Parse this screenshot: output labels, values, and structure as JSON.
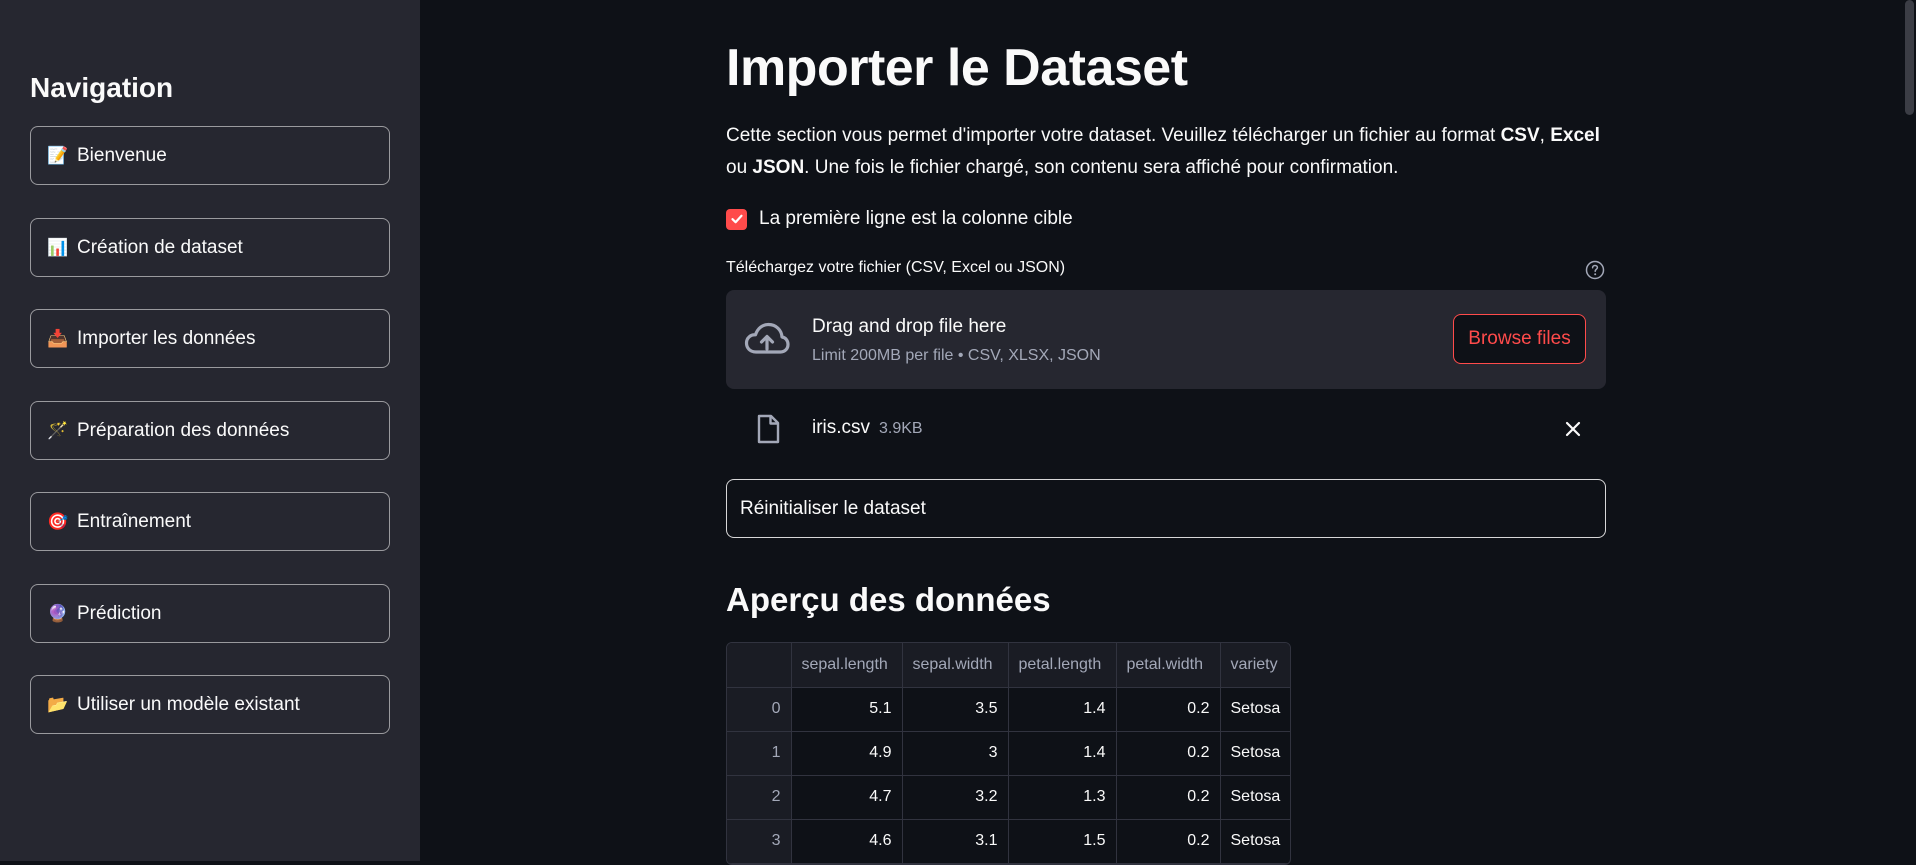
{
  "sidebar": {
    "title": "Navigation",
    "items": [
      {
        "emoji": "📝",
        "label": "Bienvenue"
      },
      {
        "emoji": "📊",
        "label": "Création de dataset"
      },
      {
        "emoji": "📥",
        "label": "Importer les données"
      },
      {
        "emoji": "🪄",
        "label": "Préparation des données"
      },
      {
        "emoji": "🎯",
        "label": "Entraînement"
      },
      {
        "emoji": "🔮",
        "label": "Prédiction"
      },
      {
        "emoji": "📂",
        "label": "Utiliser un modèle existant"
      }
    ]
  },
  "main": {
    "title": "Importer le Dataset",
    "description": {
      "p1": "Cette section vous permet d'importer votre dataset. Veuillez télécharger un fichier au format ",
      "csv": "CSV",
      "sep1": ", ",
      "excel": "Excel",
      "sep2": " ou ",
      "json": "JSON",
      "p2": ". Une fois le fichier chargé, son contenu sera affiché pour confirmation."
    },
    "checkbox_label": "La première ligne est la colonne cible",
    "checkbox_checked": true,
    "uploader": {
      "label": "Téléchargez votre fichier (CSV, Excel ou JSON)",
      "drop_text": "Drag and drop file here",
      "limit_text": "Limit 200MB per file • CSV, XLSX, JSON",
      "browse_label": "Browse files"
    },
    "file": {
      "name": "iris.csv",
      "size": "3.9KB"
    },
    "reset_label": "Réinitialiser le dataset",
    "preview_title": "Aperçu des données",
    "table": {
      "columns": [
        "sepal.length",
        "sepal.width",
        "petal.length",
        "petal.width",
        "variety"
      ],
      "rows": [
        {
          "index": "0",
          "cells": [
            "5.1",
            "3.5",
            "1.4",
            "0.2",
            "Setosa"
          ]
        },
        {
          "index": "1",
          "cells": [
            "4.9",
            "3",
            "1.4",
            "0.2",
            "Setosa"
          ]
        },
        {
          "index": "2",
          "cells": [
            "4.7",
            "3.2",
            "1.3",
            "0.2",
            "Setosa"
          ]
        },
        {
          "index": "3",
          "cells": [
            "4.6",
            "3.1",
            "1.5",
            "0.2",
            "Setosa"
          ]
        }
      ]
    }
  },
  "colors": {
    "accent": "#ff4b4b",
    "sidebar_bg": "#262730",
    "main_bg": "#0e1117"
  }
}
